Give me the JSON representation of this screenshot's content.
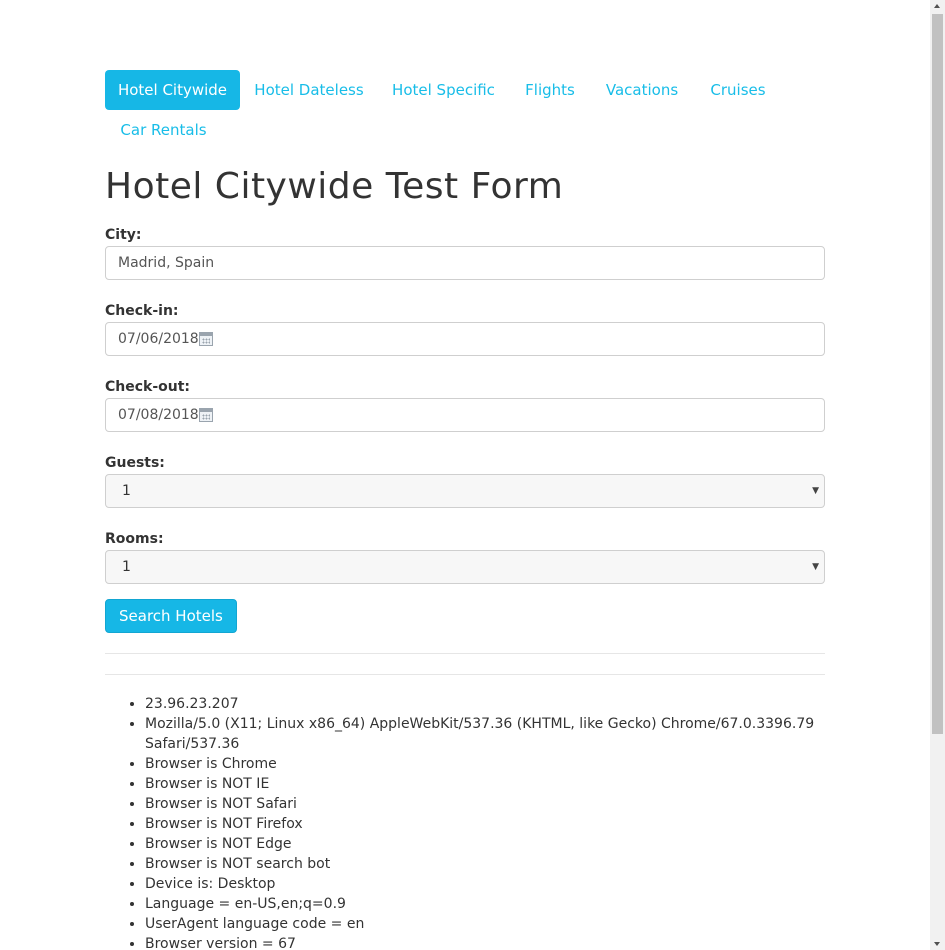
{
  "nav": {
    "tabs": [
      {
        "label": "Hotel Citywide",
        "active": true
      },
      {
        "label": "Hotel Dateless",
        "active": false
      },
      {
        "label": "Hotel Specific",
        "active": false
      },
      {
        "label": "Flights",
        "active": false
      },
      {
        "label": "Vacations",
        "active": false
      },
      {
        "label": "Cruises",
        "active": false
      },
      {
        "label": "Car Rentals",
        "active": false
      }
    ]
  },
  "form": {
    "title": "Hotel Citywide Test Form",
    "city": {
      "label": "City:",
      "value": "Madrid, Spain"
    },
    "checkin": {
      "label": "Check-in:",
      "value": "07/06/2018",
      "icon": "calendar-icon"
    },
    "checkout": {
      "label": "Check-out:",
      "value": "07/08/2018",
      "icon": "calendar-icon"
    },
    "guests": {
      "label": "Guests:",
      "value": "1"
    },
    "rooms": {
      "label": "Rooms:",
      "value": "1"
    },
    "submit_label": "Search Hotels"
  },
  "info": {
    "items": [
      "23.96.23.207",
      "Mozilla/5.0 (X11; Linux x86_64) AppleWebKit/537.36 (KHTML, like Gecko) Chrome/67.0.3396.79 Safari/537.36",
      "Browser is Chrome",
      "Browser is NOT IE",
      "Browser is NOT Safari",
      "Browser is NOT Firefox",
      "Browser is NOT Edge",
      "Browser is NOT search bot",
      "Device is: Desktop",
      "Language = en-US,en;q=0.9",
      "UserAgent language code = en",
      "Browser version = 67"
    ]
  },
  "colors": {
    "accent": "#16b7e6",
    "link": "#18bde8"
  }
}
